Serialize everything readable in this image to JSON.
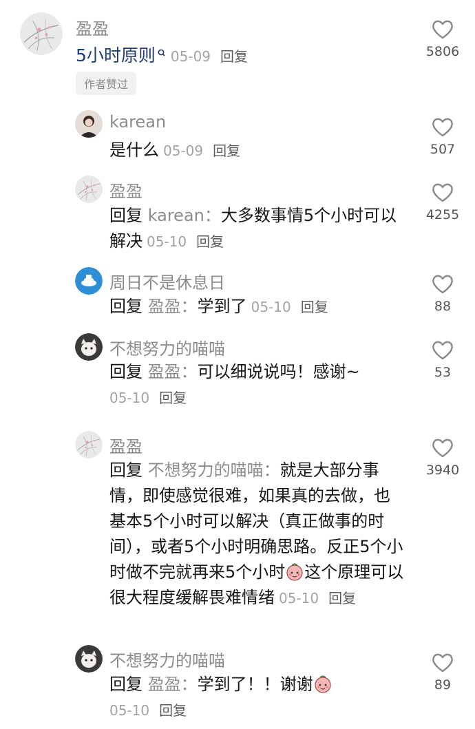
{
  "comments": [
    {
      "author": "盈盈",
      "text": "5小时原则",
      "time": "05-09",
      "reply": "回复",
      "badge": "作者赞过",
      "likes": "5806"
    },
    {
      "author": "karean",
      "text": "是什么",
      "time": "05-09",
      "reply": "回复",
      "likes": "507"
    },
    {
      "author": "盈盈",
      "reply_word": "回复",
      "mention": "karean：",
      "text": "大多数事情5个小时可以解决",
      "time": "05-10",
      "reply": "回复",
      "likes": "4255"
    },
    {
      "author": "周日不是休息日",
      "reply_word": "回复",
      "mention": "盈盈：",
      "text": "学到了",
      "time": "05-10",
      "reply": "回复",
      "likes": "88"
    },
    {
      "author": "不想努力的喵喵",
      "reply_word": "回复",
      "mention": "盈盈：",
      "text": "可以细说说吗！感谢~",
      "time": "05-10",
      "reply": "回复",
      "likes": "53"
    },
    {
      "author": "盈盈",
      "reply_word": "回复",
      "mention": "不想努力的喵喵：",
      "text_a": "就是大部分事情，即使感觉很难，如果真的去做，也基本5个小时可以解决（真正做事的时间），或者5个小时明确思路。反正5个小时做不完就再来5个小时",
      "text_b": "这个原理可以很大程度缓解畏难情绪",
      "time": "05-10",
      "reply": "回复",
      "likes": "3940"
    },
    {
      "author": "不想努力的喵喵",
      "reply_word": "回复",
      "mention": "盈盈：",
      "text": "学到了！！谢谢",
      "time": "05-10",
      "reply": "回复",
      "likes": "89"
    }
  ],
  "colors": {
    "name": "#8c8c8c",
    "body": "#161616",
    "meta": "#a3a3a3",
    "link": "#1e3c7a"
  }
}
